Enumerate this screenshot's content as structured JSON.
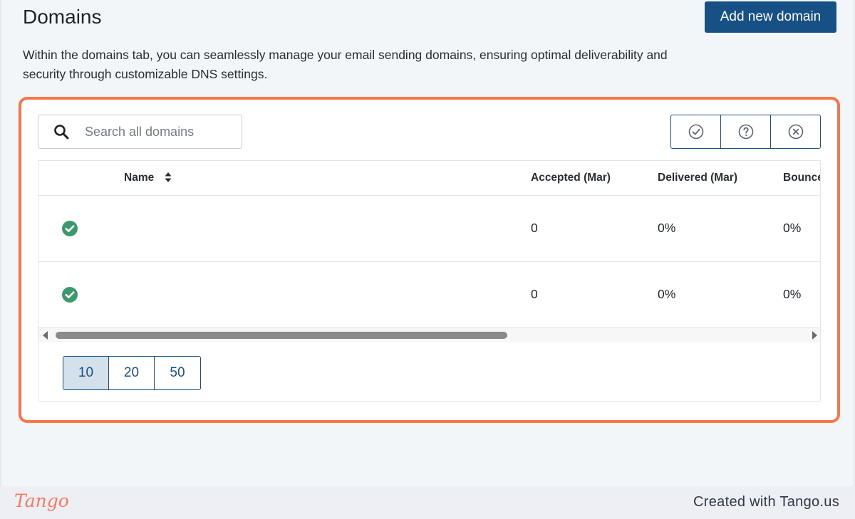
{
  "page": {
    "title": "Domains",
    "add_button_label": "Add new domain",
    "description": "Within the domains tab, you can seamlessly manage your email sending domains, ensuring optimal deliverability and security through customizable DNS settings."
  },
  "search": {
    "placeholder": "Search all domains",
    "value": ""
  },
  "filters": [
    {
      "icon": "check-circle-icon"
    },
    {
      "icon": "question-circle-icon"
    },
    {
      "icon": "x-circle-icon"
    }
  ],
  "table": {
    "columns": [
      "Name",
      "Accepted (Mar)",
      "Delivered (Mar)",
      "Bounce"
    ],
    "rows": [
      {
        "status": "verified",
        "name": "",
        "accepted": "0",
        "delivered": "0%",
        "bounce": "0%"
      },
      {
        "status": "verified",
        "name": "",
        "accepted": "0",
        "delivered": "0%",
        "bounce": "0%"
      }
    ]
  },
  "pagination": {
    "options": [
      "10",
      "20",
      "50"
    ],
    "selected": "10"
  },
  "footer": {
    "logo": "Tango",
    "credit": "Created with Tango.us"
  },
  "colors": {
    "primary": "#175084",
    "highlight": "#f5774a",
    "success": "#3a9a6e",
    "page_bg": "#f3f6f9"
  }
}
